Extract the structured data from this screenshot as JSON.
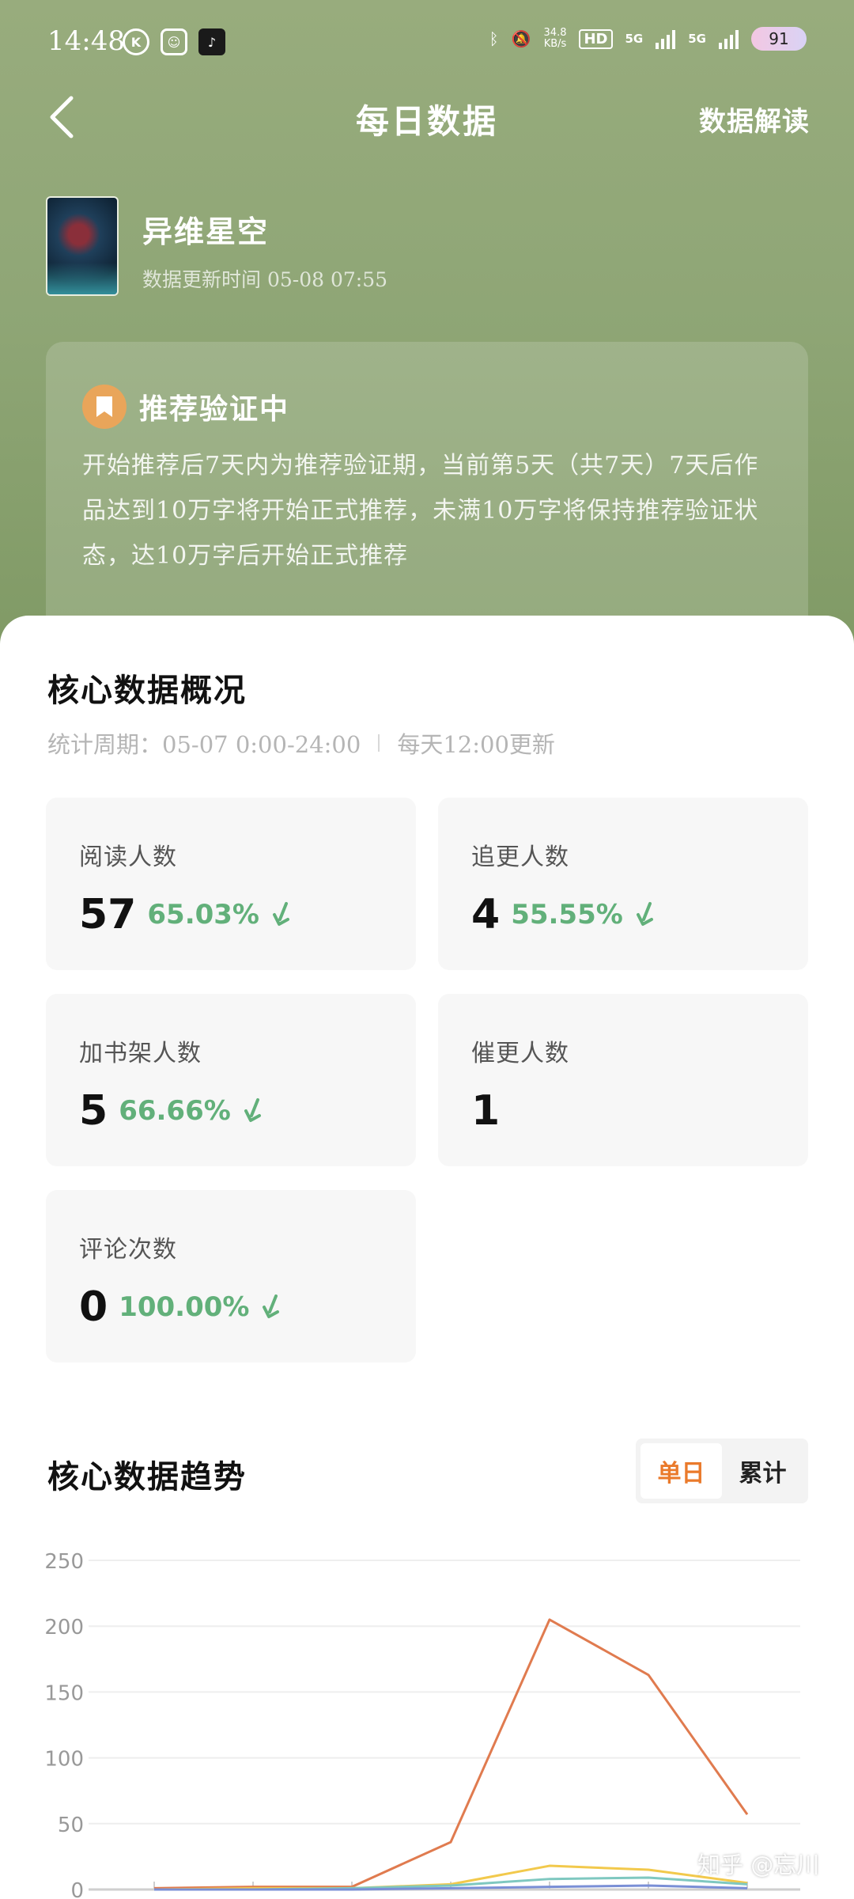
{
  "status_bar": {
    "time": "14:48",
    "net_speed_value": "34.8",
    "net_speed_unit": "KB/s",
    "hd": "HD",
    "sim1": "5G",
    "sim2": "5G",
    "battery": "91"
  },
  "nav": {
    "title": "每日数据",
    "right_action": "数据解读"
  },
  "book": {
    "name": "异维星空",
    "update_time": "数据更新时间 05-08 07:55"
  },
  "notice": {
    "title": "推荐验证中",
    "text": "开始推荐后7天内为推荐验证期，当前第5天（共7天）7天后作品达到10万字将开始正式推荐，未满10万字将保持推荐验证状态，达10万字后开始正式推荐"
  },
  "overview": {
    "title": "核心数据概况",
    "period": "统计周期：05-07 0:00-24:00",
    "update_rule": "每天12:00更新",
    "stats": [
      {
        "label": "阅读人数",
        "value": "57",
        "change": "65.03%",
        "trend": "down"
      },
      {
        "label": "追更人数",
        "value": "4",
        "change": "55.55%",
        "trend": "down"
      },
      {
        "label": "加书架人数",
        "value": "5",
        "change": "66.66%",
        "trend": "down"
      },
      {
        "label": "催更人数",
        "value": "1",
        "change": "",
        "trend": "none"
      },
      {
        "label": "评论次数",
        "value": "0",
        "change": "100.00%",
        "trend": "down"
      }
    ]
  },
  "trend": {
    "title": "核心数据趋势",
    "toggle": {
      "daily": "单日",
      "cumulative": "累计",
      "selected": "daily"
    }
  },
  "colors": {
    "accent": "#ea7a2b",
    "down_green": "#62b07a",
    "header_green": "#8fa676"
  },
  "watermark": "知乎 @忘川",
  "chart_data": {
    "type": "line",
    "ylim": [
      0,
      250
    ],
    "yticks": [
      0,
      50,
      100,
      150,
      200,
      250
    ],
    "x": [
      1,
      2,
      3,
      4,
      5,
      6,
      7
    ],
    "series": [
      {
        "values": [
          1,
          2,
          2,
          36,
          205,
          163,
          57
        ],
        "color": "#e07b4f"
      },
      {
        "values": [
          0,
          1,
          1,
          4,
          18,
          15,
          5
        ],
        "color": "#f2c94c"
      },
      {
        "values": [
          0,
          0,
          1,
          3,
          8,
          9,
          4
        ],
        "color": "#7fc8c0"
      },
      {
        "values": [
          0,
          0,
          0,
          1,
          2,
          3,
          1
        ],
        "color": "#7a8fd6"
      }
    ],
    "grid": true
  }
}
